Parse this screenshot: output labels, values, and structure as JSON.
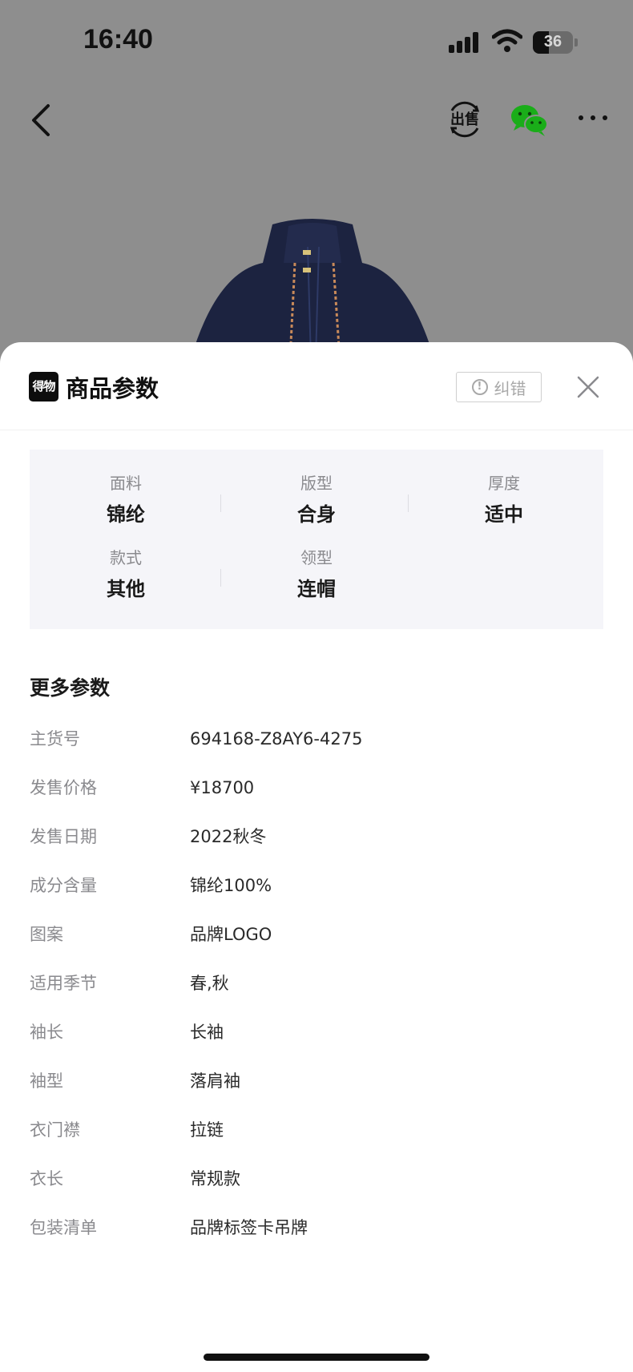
{
  "status_bar": {
    "time": "16:40",
    "battery": "36"
  },
  "nav": {
    "sell_label": "出售"
  },
  "sheet": {
    "logo_text": "得物",
    "title": "商品参数",
    "correct_label": "纠错",
    "params": [
      {
        "key": "面料",
        "value": "锦纶"
      },
      {
        "key": "版型",
        "value": "合身"
      },
      {
        "key": "厚度",
        "value": "适中"
      },
      {
        "key": "款式",
        "value": "其他"
      },
      {
        "key": "领型",
        "value": "连帽"
      }
    ],
    "more_title": "更多参数",
    "specs": [
      {
        "key": "主货号",
        "value": "694168-Z8AY6-4275"
      },
      {
        "key": "发售价格",
        "value": "¥18700"
      },
      {
        "key": "发售日期",
        "value": "2022秋冬"
      },
      {
        "key": "成分含量",
        "value": "锦纶100%"
      },
      {
        "key": "图案",
        "value": "品牌LOGO"
      },
      {
        "key": "适用季节",
        "value": "春,秋"
      },
      {
        "key": "袖长",
        "value": "长袖"
      },
      {
        "key": "袖型",
        "value": "落肩袖"
      },
      {
        "key": "衣门襟",
        "value": "拉链"
      },
      {
        "key": "衣长",
        "value": "常规款"
      },
      {
        "key": "包装清单",
        "value": "品牌标签卡吊牌"
      }
    ]
  },
  "colors": {
    "overlay_bg": "#8e8e8e",
    "sheet_bg": "#ffffff",
    "param_panel_bg": "#f5f5f9",
    "label_gray": "#8a8a8e",
    "wechat_green": "#1aad19"
  },
  "icons": [
    "back-icon",
    "sell-icon",
    "wechat-icon",
    "more-icon",
    "warning-icon",
    "close-icon"
  ]
}
